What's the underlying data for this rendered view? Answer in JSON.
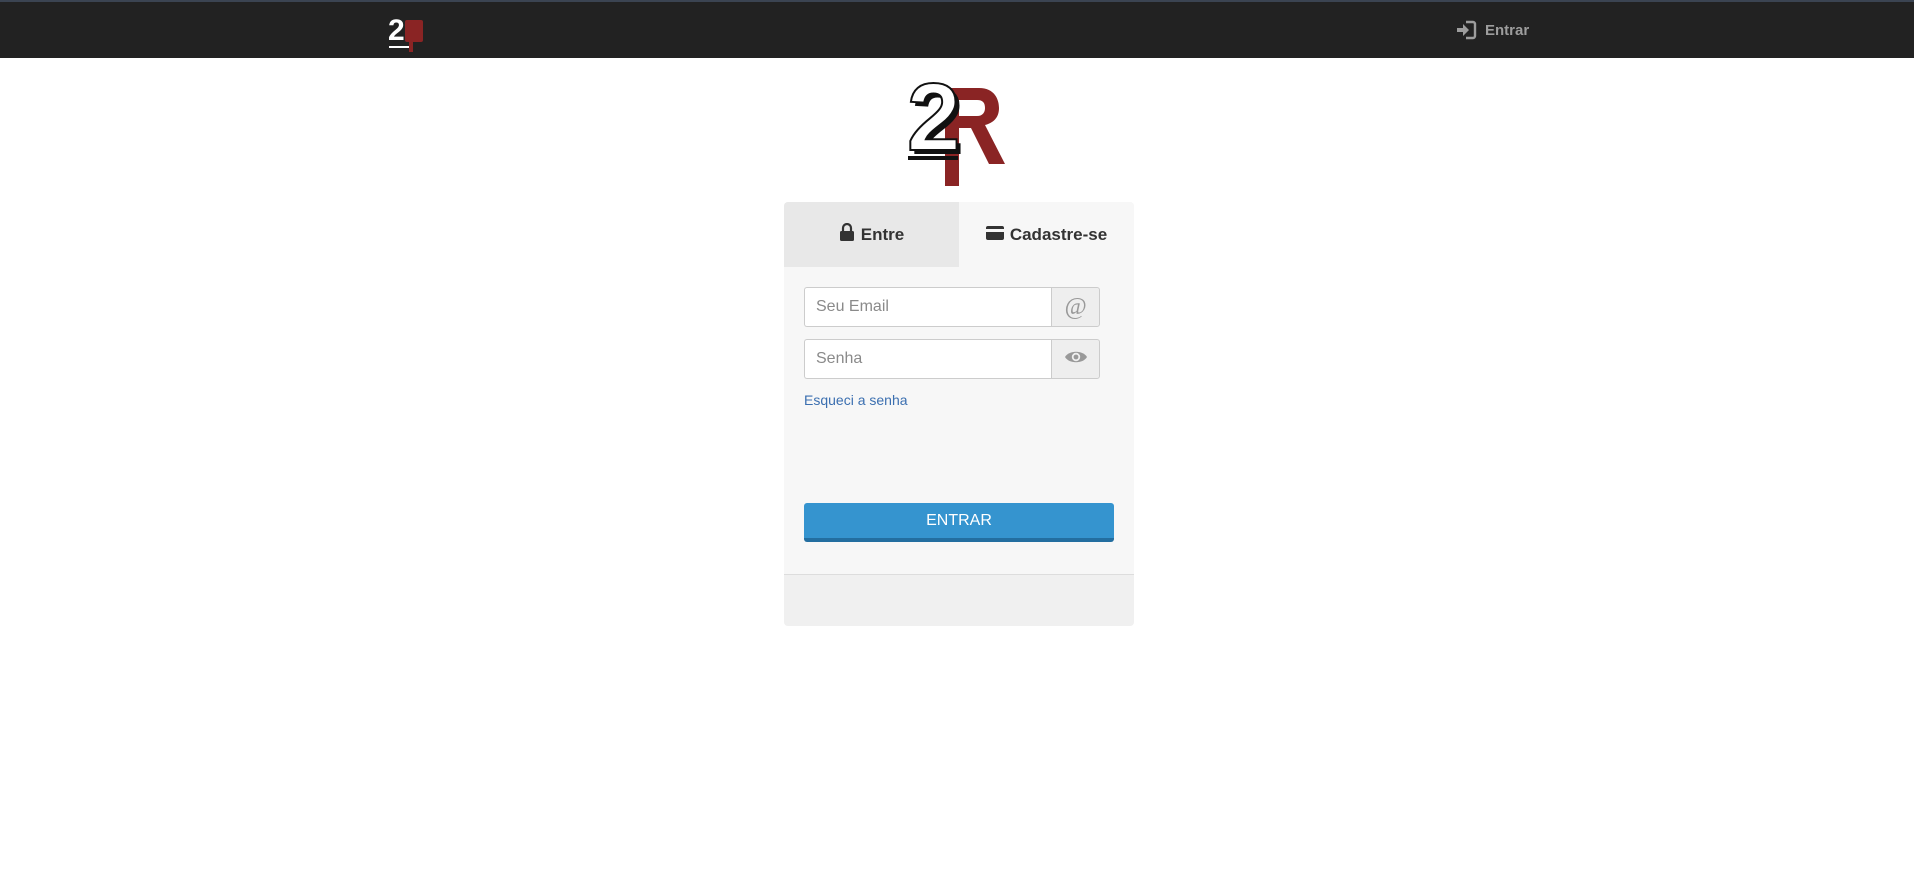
{
  "navbar": {
    "login_label": "Entrar"
  },
  "login_card": {
    "tabs": [
      {
        "label": "Entre",
        "icon": "lock-icon",
        "active": true
      },
      {
        "label": "Cadastre-se",
        "icon": "credit-card-icon",
        "active": false
      }
    ],
    "email": {
      "value": "",
      "placeholder": "Seu Email",
      "addon_symbol": "@"
    },
    "password": {
      "value": "",
      "placeholder": "Senha",
      "addon_icon": "eye-icon"
    },
    "forgot_link": "Esqueci a senha",
    "submit_label": "ENTRAR"
  },
  "colors": {
    "navbar_bg": "#222222",
    "brand_red": "#8a2424",
    "button_blue": "#3594cf",
    "link_blue": "#3b6fb0"
  }
}
